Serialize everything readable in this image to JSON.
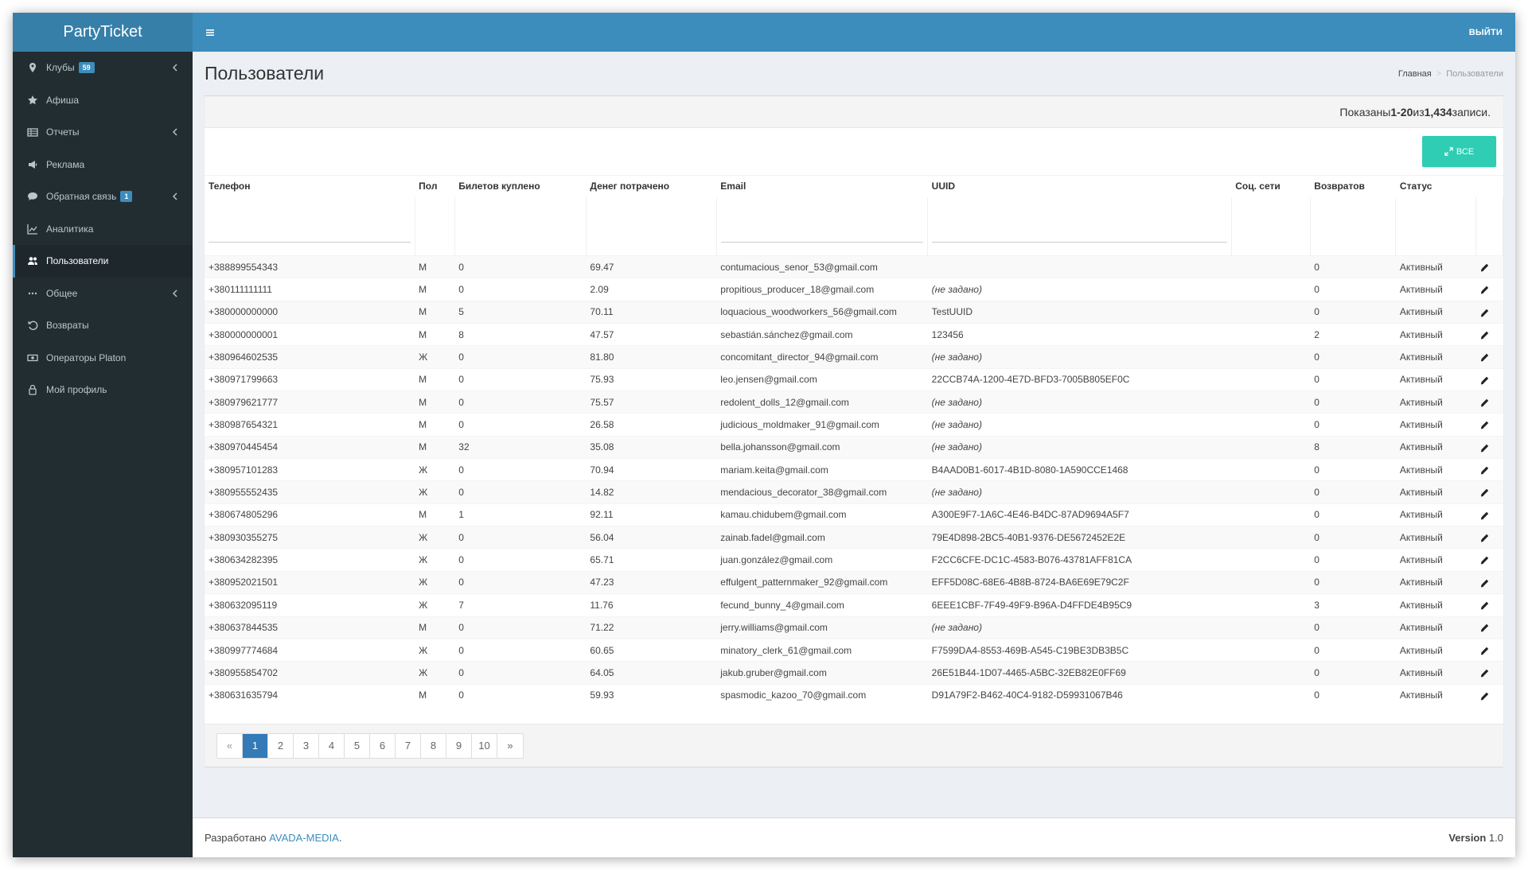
{
  "app": {
    "logo": "PartyTicket"
  },
  "sidebar": {
    "items": [
      {
        "label": "Клубы",
        "badge": "59",
        "icon": "map-marker-icon",
        "chevron": true,
        "active": false
      },
      {
        "label": "Афиша",
        "badge": "",
        "icon": "star-icon",
        "chevron": false,
        "active": false
      },
      {
        "label": "Отчеты",
        "badge": "",
        "icon": "table-icon",
        "chevron": true,
        "active": false
      },
      {
        "label": "Реклама",
        "badge": "",
        "icon": "bullhorn-icon",
        "chevron": false,
        "active": false
      },
      {
        "label": "Обратная связь",
        "badge": "1",
        "icon": "comment-icon",
        "chevron": true,
        "active": false
      },
      {
        "label": "Аналитика",
        "badge": "",
        "icon": "line-chart-icon",
        "chevron": false,
        "active": false
      },
      {
        "label": "Пользователи",
        "badge": "",
        "icon": "users-icon",
        "chevron": false,
        "active": true
      },
      {
        "label": "Общее",
        "badge": "",
        "icon": "ellipsis-icon",
        "chevron": true,
        "active": false
      },
      {
        "label": "Возвраты",
        "badge": "",
        "icon": "undo-icon",
        "chevron": false,
        "active": false
      },
      {
        "label": "Операторы Platon",
        "badge": "",
        "icon": "money-icon",
        "chevron": false,
        "active": false
      },
      {
        "label": "Мой профиль",
        "badge": "",
        "icon": "user-icon",
        "chevron": false,
        "active": false
      }
    ]
  },
  "topbar": {
    "logout": "ВЫЙТИ"
  },
  "header": {
    "title": "Пользователи",
    "breadcrumb": {
      "home": "Главная",
      "sep": ">",
      "current": "Пользователи"
    }
  },
  "summary": {
    "prefix": "Показаны ",
    "range": "1-20",
    "middle": " из ",
    "total": "1,434",
    "suffix": " записи."
  },
  "buttons": {
    "all": "ВСЕ"
  },
  "table": {
    "headers": [
      "Телефон",
      "Пол",
      "Билетов куплено",
      "Денег потрачено",
      "Email",
      "UUID",
      "Соц. сети",
      "Возвратов",
      "Статус",
      ""
    ],
    "not_set": "(не задано)",
    "rows": [
      [
        "+388899554343",
        "М",
        "0",
        "69.47",
        "contumacious_senor_53@gmail.com",
        "",
        "",
        "0",
        "Активный"
      ],
      [
        "+380111111111",
        "М",
        "0",
        "2.09",
        "propitious_producer_18@gmail.com",
        null,
        "",
        "0",
        "Активный"
      ],
      [
        "+380000000000",
        "М",
        "5",
        "70.11",
        "loquacious_woodworkers_56@gmail.com",
        "TestUUID",
        "",
        "0",
        "Активный"
      ],
      [
        "+380000000001",
        "М",
        "8",
        "47.57",
        "sebastián.sánchez@gmail.com",
        "123456",
        "",
        "2",
        "Активный"
      ],
      [
        "+380964602535",
        "Ж",
        "0",
        "81.80",
        "concomitant_director_94@gmail.com",
        null,
        "",
        "0",
        "Активный"
      ],
      [
        "+380971799663",
        "М",
        "0",
        "75.93",
        "leo.jensen@gmail.com",
        "22CCB74A-1200-4E7D-BFD3-7005B805EF0C",
        "",
        "0",
        "Активный"
      ],
      [
        "+380979621777",
        "М",
        "0",
        "75.57",
        "redolent_dolls_12@gmail.com",
        null,
        "",
        "0",
        "Активный"
      ],
      [
        "+380987654321",
        "М",
        "0",
        "26.58",
        "judicious_moldmaker_91@gmail.com",
        null,
        "",
        "0",
        "Активный"
      ],
      [
        "+380970445454",
        "М",
        "32",
        "35.08",
        "bella.johansson@gmail.com",
        null,
        "",
        "8",
        "Активный"
      ],
      [
        "+380957101283",
        "Ж",
        "0",
        "70.94",
        "mariam.keita@gmail.com",
        "B4AAD0B1-6017-4B1D-8080-1A590CCE1468",
        "",
        "0",
        "Активный"
      ],
      [
        "+380955552435",
        "Ж",
        "0",
        "14.82",
        "mendacious_decorator_38@gmail.com",
        null,
        "",
        "0",
        "Активный"
      ],
      [
        "+380674805296",
        "М",
        "1",
        "92.11",
        "kamau.chidubem@gmail.com",
        "A300E9F7-1A6C-4E46-B4DC-87AD9694A5F7",
        "",
        "0",
        "Активный"
      ],
      [
        "+380930355275",
        "Ж",
        "0",
        "56.04",
        "zainab.fadel@gmail.com",
        "79E4D898-2BC5-40B1-9376-DE5672452E2E",
        "",
        "0",
        "Активный"
      ],
      [
        "+380634282395",
        "Ж",
        "0",
        "65.71",
        "juan.gonzález@gmail.com",
        "F2CC6CFE-DC1C-4583-B076-43781AFF81CA",
        "",
        "0",
        "Активный"
      ],
      [
        "+380952021501",
        "Ж",
        "0",
        "47.23",
        "effulgent_patternmaker_92@gmail.com",
        "EFF5D08C-68E6-4B8B-8724-BA6E69E79C2F",
        "",
        "0",
        "Активный"
      ],
      [
        "+380632095119",
        "Ж",
        "7",
        "11.76",
        "fecund_bunny_4@gmail.com",
        "6EEE1CBF-7F49-49F9-B96A-D4FFDE4B95C9",
        "",
        "3",
        "Активный"
      ],
      [
        "+380637844535",
        "М",
        "0",
        "71.22",
        "jerry.williams@gmail.com",
        null,
        "",
        "0",
        "Активный"
      ],
      [
        "+380997774684",
        "Ж",
        "0",
        "60.65",
        "minatory_clerk_61@gmail.com",
        "F7599DA4-8553-469B-A545-C19BE3DB3B5C",
        "",
        "0",
        "Активный"
      ],
      [
        "+380955854702",
        "Ж",
        "0",
        "64.05",
        "jakub.gruber@gmail.com",
        "26E51B44-1D07-4465-A5BC-32EB82E0FF69",
        "",
        "0",
        "Активный"
      ],
      [
        "+380631635794",
        "М",
        "0",
        "59.93",
        "spasmodic_kazoo_70@gmail.com",
        "D91A79F2-B462-40C4-9182-D59931067B46",
        "",
        "0",
        "Активный"
      ]
    ]
  },
  "pagination": {
    "prev": "«",
    "pages": [
      "1",
      "2",
      "3",
      "4",
      "5",
      "6",
      "7",
      "8",
      "9",
      "10"
    ],
    "current": "1",
    "next": "»"
  },
  "footer": {
    "developed_by": "Разработано ",
    "company": "AVADA-MEDIA",
    "dot": ".",
    "version_label": "Version",
    "version": " 1.0"
  },
  "colors": {
    "sidebar_bg": "#222d32",
    "header_bg": "#3c8dbc",
    "logo_bg": "#367fa9",
    "accent": "#3c8dbc",
    "button_all": "#2ecdb4",
    "not_set": "#dd4b39"
  }
}
